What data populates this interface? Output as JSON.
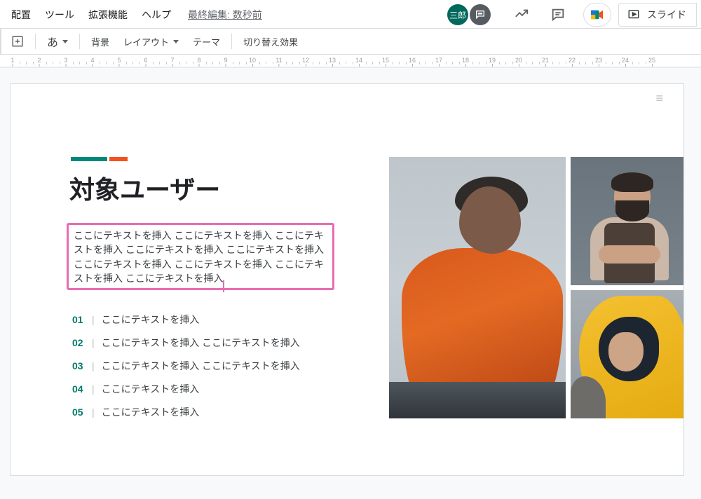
{
  "menu": {
    "items": [
      "配置",
      "ツール",
      "拡張機能",
      "ヘルプ"
    ],
    "last_edit": "最終編集: 数秒前"
  },
  "header": {
    "avatar_label": "三郎",
    "slideshow_label": "スライド"
  },
  "toolbar": {
    "ime_label": "あ",
    "background": "背景",
    "layout": "レイアウト",
    "theme": "テーマ",
    "transition": "切り替え効果"
  },
  "ruler": {
    "start": 1,
    "end": 25
  },
  "slide": {
    "title": "対象ユーザー",
    "body": "ここにテキストを挿入 ここにテキストを挿入 ここにテキストを挿入 ここにテキストを挿入 ここにテキストを挿入 ここにテキストを挿入 ここにテキストを挿入 ここにテキストを挿入 ここにテキストを挿入",
    "list": [
      {
        "num": "01",
        "text": "ここにテキストを挿入"
      },
      {
        "num": "02",
        "text": "ここにテキストを挿入 ここにテキストを挿入"
      },
      {
        "num": "03",
        "text": "ここにテキストを挿入 ここにテキストを挿入"
      },
      {
        "num": "04",
        "text": "ここにテキストを挿入"
      },
      {
        "num": "05",
        "text": "ここにテキストを挿入"
      }
    ],
    "accent_colors": {
      "teal": "#00897b",
      "orange": "#f4511e"
    },
    "selection_color": "#e86cb4"
  }
}
